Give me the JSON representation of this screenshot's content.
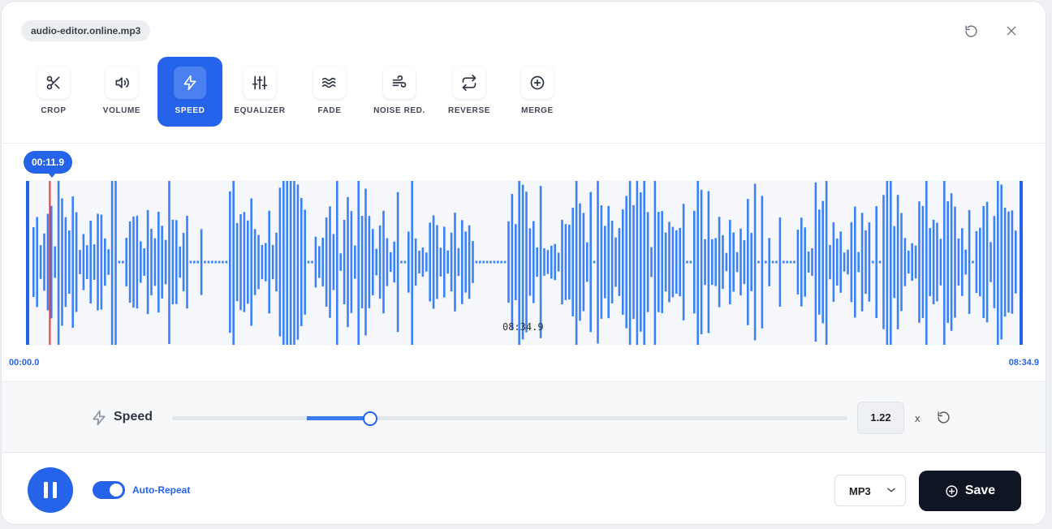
{
  "file": {
    "name": "audio-editor.online.mp3"
  },
  "header": {
    "undo_icon": "undo-icon",
    "close_icon": "close-icon"
  },
  "tools": [
    {
      "label": "CROP",
      "icon": "scissors-icon"
    },
    {
      "label": "VOLUME",
      "icon": "volume-icon"
    },
    {
      "label": "SPEED",
      "icon": "lightning-icon",
      "active": true
    },
    {
      "label": "EQUALIZER",
      "icon": "equalizer-icon"
    },
    {
      "label": "FADE",
      "icon": "waves-icon"
    },
    {
      "label": "NOISE RED.",
      "icon": "wind-icon"
    },
    {
      "label": "REVERSE",
      "icon": "repeat-icon"
    },
    {
      "label": "MERGE",
      "icon": "plus-circle-icon"
    }
  ],
  "waveform": {
    "playhead_time": "00:11.9",
    "center_time": "08:34.9",
    "start_time": "00:00.0",
    "end_time": "08:34.9",
    "playhead_fraction": 0.0231,
    "bar_color": "#3b82f6",
    "playhead_color": "#e53935"
  },
  "speed": {
    "label": "Speed",
    "value": "1.22",
    "unit": "x"
  },
  "bottom": {
    "auto_repeat_label": "Auto-Repeat",
    "auto_repeat_on": true,
    "format": "MP3",
    "save_label": "Save"
  },
  "colors": {
    "accent": "#2563eb",
    "dark": "#0f1523"
  }
}
